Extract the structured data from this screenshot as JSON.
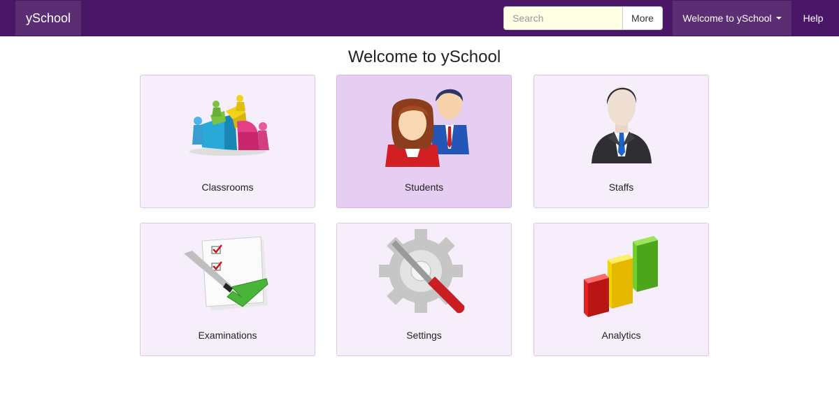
{
  "navbar": {
    "brand": "ySchool",
    "search": {
      "placeholder": "Search",
      "value": ""
    },
    "more_label": "More",
    "welcome_menu": "Welcome to ySchool",
    "help_label": "Help"
  },
  "page_title": "Welcome to ySchool",
  "tiles": [
    {
      "label": "Classrooms",
      "icon": "classroom-puzzle-icon"
    },
    {
      "label": "Students",
      "icon": "students-icon",
      "state": "hover"
    },
    {
      "label": "Staffs",
      "icon": "staff-icon"
    },
    {
      "label": "Examinations",
      "icon": "exam-checklist-icon"
    },
    {
      "label": "Settings",
      "icon": "settings-gear-icon"
    },
    {
      "label": "Analytics",
      "icon": "analytics-bars-icon"
    }
  ],
  "colors": {
    "navbar_bg": "#4a1767",
    "tile_bg": "#f7eefb",
    "tile_active_bg": "#e6cdf2"
  }
}
